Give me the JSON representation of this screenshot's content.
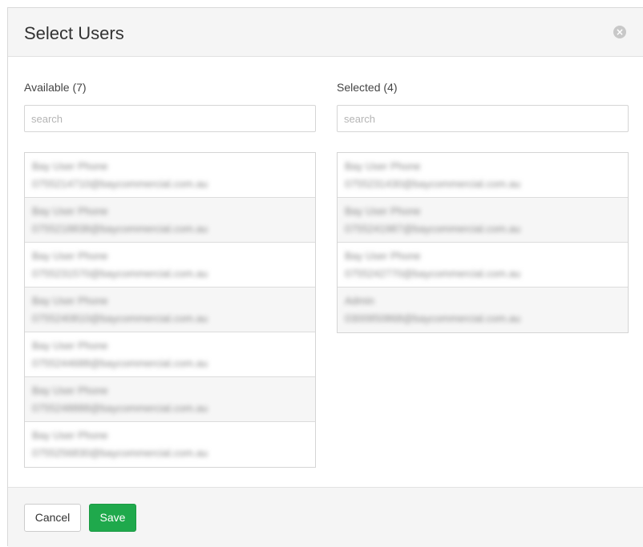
{
  "dialog": {
    "title": "Select Users",
    "close_icon": "close-circle-icon"
  },
  "available": {
    "label": "Available (7)",
    "search_placeholder": "search",
    "users": [
      {
        "name": "Bay User Phone",
        "email": "0755214710@baycommercial.com.au"
      },
      {
        "name": "Bay User Phone",
        "email": "0755218838@baycommercial.com.au"
      },
      {
        "name": "Bay User Phone",
        "email": "0755231570@baycommercial.com.au"
      },
      {
        "name": "Bay User Phone",
        "email": "0755240810@baycommercial.com.au"
      },
      {
        "name": "Bay User Phone",
        "email": "0755244688@baycommercial.com.au"
      },
      {
        "name": "Bay User Phone",
        "email": "0755248888@baycommercial.com.au"
      },
      {
        "name": "Bay User Phone",
        "email": "0755256830@baycommercial.com.au"
      }
    ]
  },
  "selected": {
    "label": "Selected (4)",
    "search_placeholder": "search",
    "users": [
      {
        "name": "Bay User Phone",
        "email": "0755231430@baycommercial.com.au"
      },
      {
        "name": "Bay User Phone",
        "email": "0755241987@baycommercial.com.au"
      },
      {
        "name": "Bay User Phone",
        "email": "0755242770@baycommercial.com.au"
      },
      {
        "name": "Admin",
        "email": "0300950868@baycommercial.com.au"
      }
    ]
  },
  "footer": {
    "cancel_label": "Cancel",
    "save_label": "Save"
  },
  "colors": {
    "save_button": "#1fa94c",
    "header_bg": "#f5f5f5",
    "alt_row_bg": "#f6f6f6"
  }
}
